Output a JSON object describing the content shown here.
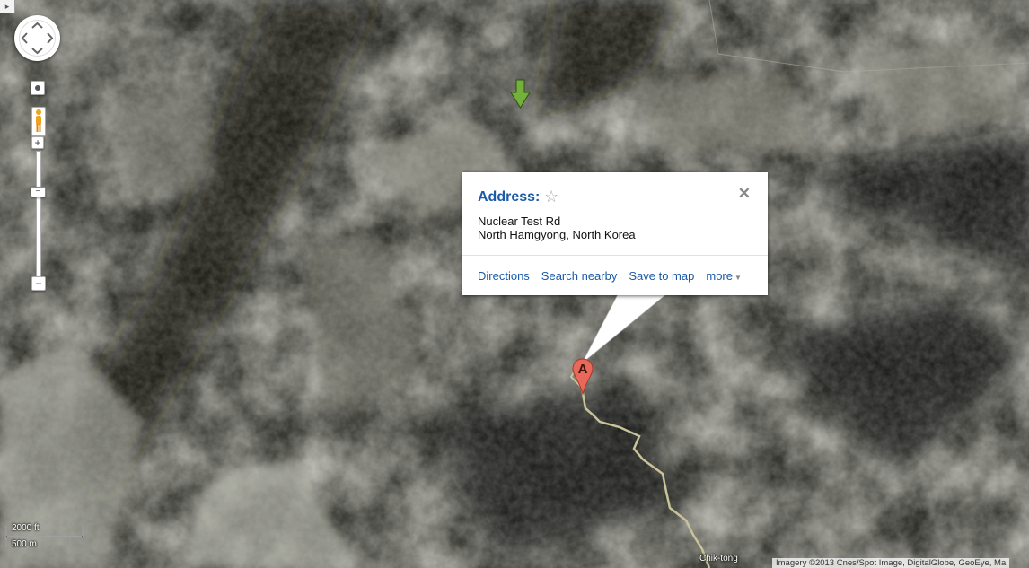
{
  "info_window": {
    "title": "Address:",
    "star_icon": "star-outline-icon",
    "close_icon": "close-icon",
    "address_line1": "Nuclear Test Rd",
    "address_line2": "North Hamgyong, North Korea",
    "links": {
      "directions": "Directions",
      "search_nearby": "Search nearby",
      "save_to_map": "Save to map",
      "more": "more"
    }
  },
  "marker": {
    "label": "A",
    "color": "#e8685a"
  },
  "green_marker_color": "#74b03c",
  "scale": {
    "imperial": "2000 ft",
    "metric": "500 m"
  },
  "place_labels": {
    "chik_tong": "Chik-tong"
  },
  "attribution": "Imagery ©2013 Cnes/Spot Image, DigitalGlobe, GeoEye, Ma",
  "controls": {
    "pan_icon": "pan-arrows-icon",
    "pegman_icon": "pegman-icon",
    "zoom_in": "+",
    "zoom_out": "−",
    "zoom_out_bottom": "−",
    "center_icon": "dot-icon"
  },
  "colors": {
    "link": "#1a5aa6",
    "road": "#c9c39a"
  }
}
